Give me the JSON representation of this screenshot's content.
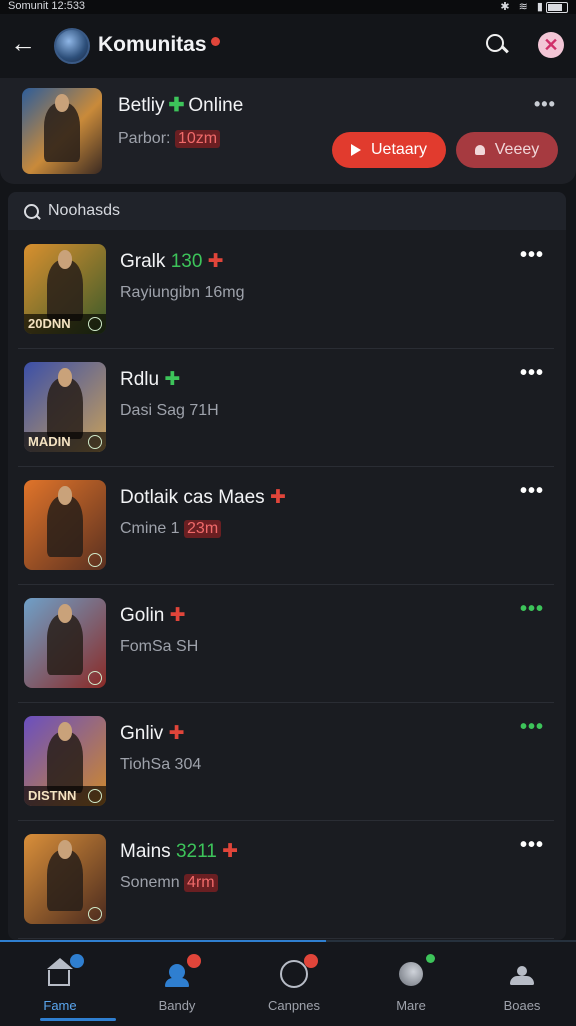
{
  "status_bar": {
    "time": "Somunit 12:533"
  },
  "header": {
    "title": "Komunitas"
  },
  "featured": {
    "name": "Betliy",
    "status": "Online",
    "sub_prefix": "Parbor:",
    "sub_tag": "10zm",
    "more": "•••",
    "primary_button": "Uetaary",
    "secondary_button": "Veeey",
    "thumb_gradient": "#c98a3a"
  },
  "list": {
    "search_label": "Noohasds",
    "members": [
      {
        "name": "Gralk",
        "tag": "130",
        "tag_color": "#3dc45a",
        "icon_color": "#e0453a",
        "sub": "Rayiungibn 16mg",
        "sub_tag": "",
        "caption": "20DNN",
        "more_color": "#ffffff",
        "thumb_from": "#d9902f",
        "thumb_to": "#3a5a2a"
      },
      {
        "name": "Rdlu",
        "tag": "",
        "tag_color": "#3dc45a",
        "icon_color": "#3dc45a",
        "sub": "Dasi Sag 71H",
        "sub_tag": "",
        "caption": "MADIN",
        "more_color": "#ffffff",
        "thumb_from": "#3b4fa8",
        "thumb_to": "#c9a15a"
      },
      {
        "name": "Dotlaik cas Maes",
        "tag": "",
        "tag_color": "#3dc45a",
        "icon_color": "#e0453a",
        "sub": "Cmine 1",
        "sub_tag": "23m",
        "caption": "",
        "more_color": "#ffffff",
        "thumb_from": "#e0742a",
        "thumb_to": "#5a3020"
      },
      {
        "name": "Golin",
        "tag": "",
        "tag_color": "#3dc45a",
        "icon_color": "#e0453a",
        "sub": "FomSa SH",
        "sub_tag": "",
        "caption": "",
        "more_color": "#3dc45a",
        "thumb_from": "#6fa0c8",
        "thumb_to": "#8a2a26"
      },
      {
        "name": "Gnliv",
        "tag": "",
        "tag_color": "#3dc45a",
        "icon_color": "#e0453a",
        "sub": "TiohSa 304",
        "sub_tag": "",
        "caption": "DISTNN",
        "more_color": "#3dc45a",
        "thumb_from": "#6a4fc0",
        "thumb_to": "#d08a2a"
      },
      {
        "name": "Mains",
        "tag": "3211",
        "tag_color": "#3dc45a",
        "icon_color": "#e0453a",
        "sub": "Sonemn",
        "sub_tag": "4rm",
        "caption": "",
        "more_color": "#ffffff",
        "thumb_from": "#d98f3a",
        "thumb_to": "#4a2a1e"
      }
    ]
  },
  "nav": {
    "items": [
      {
        "label": "Fame",
        "icon": "home-icon",
        "badge": ""
      },
      {
        "label": "Bandy",
        "icon": "squad-icon",
        "badge": ""
      },
      {
        "label": "Canpnes",
        "icon": "circle-icon",
        "badge": ""
      },
      {
        "label": "Mare",
        "icon": "ball-icon",
        "badge": ""
      },
      {
        "label": "Boaes",
        "icon": "group-icon",
        "badge": ""
      }
    ]
  },
  "colors": {
    "accent": "#e13b2e",
    "online": "#3dc45a",
    "nav_active": "#2f7fd0"
  }
}
